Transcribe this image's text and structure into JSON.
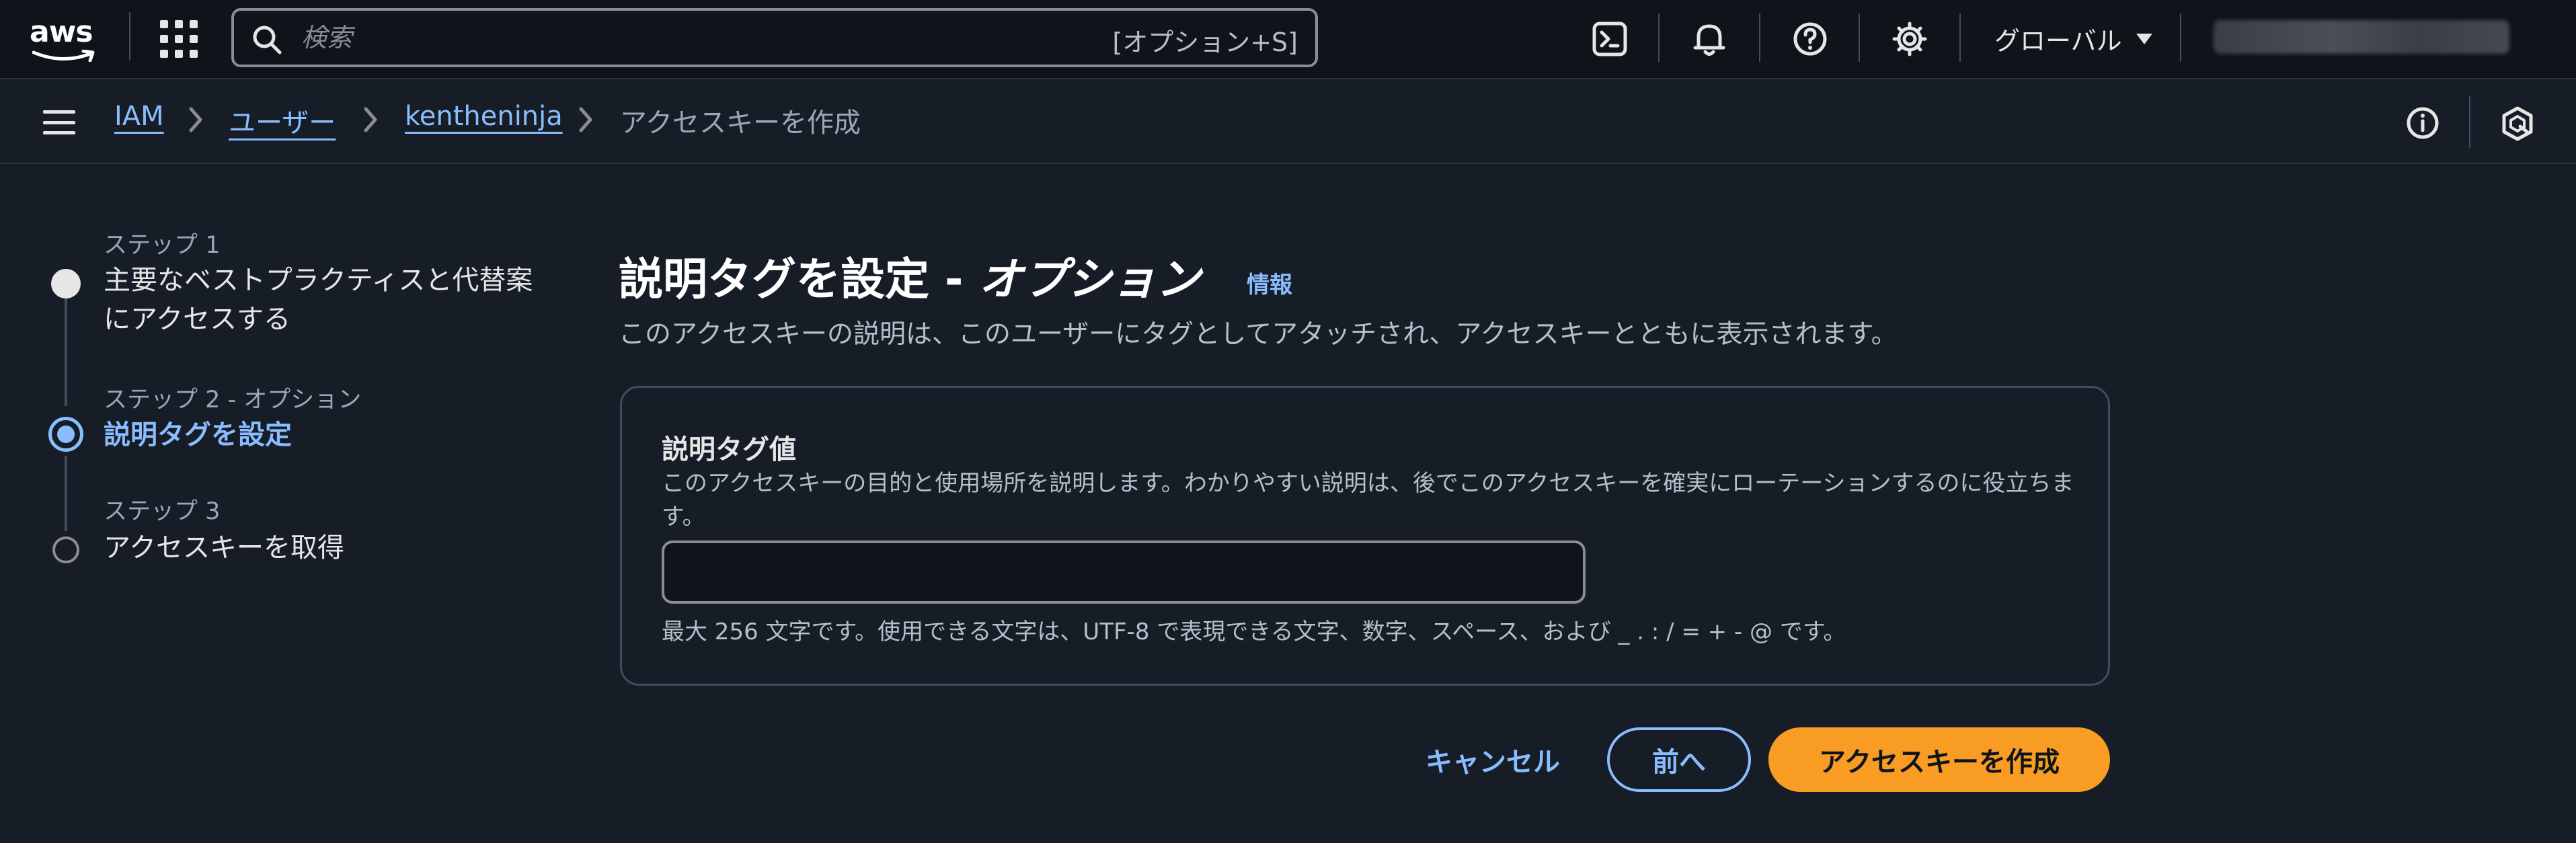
{
  "topnav": {
    "logo_text": "aws",
    "search_placeholder": "検索",
    "search_shortcut": "[オプション+S]",
    "icons": [
      "grid-icon",
      "search-icon",
      "cloudshell-icon",
      "bell-icon",
      "help-icon",
      "gear-icon",
      "caret-down-icon"
    ],
    "region_label": "グローバル"
  },
  "breadcrumb": {
    "items": [
      "IAM",
      "ユーザー",
      "kentheninja",
      "アクセスキーを作成"
    ]
  },
  "steps": [
    {
      "label": "ステップ 1",
      "title_lines": [
        "主要なベストプラクティスと代替案",
        "にアクセスする"
      ],
      "state": "completed"
    },
    {
      "label": "ステップ 2 - オプション",
      "title_lines": [
        "説明タグを設定"
      ],
      "state": "active"
    },
    {
      "label": "ステップ 3",
      "title_lines": [
        "アクセスキーを取得"
      ],
      "state": "pending"
    }
  ],
  "main": {
    "title_main": "説明タグを設定 - ",
    "title_optional": "オプション",
    "info_link": "情報",
    "description": "このアクセスキーの説明は、このユーザーにタグとしてアタッチされ、アクセスキーとともに表示されます。",
    "field": {
      "label": "説明タグ値",
      "description": "このアクセスキーの目的と使用場所を説明します。わかりやすい説明は、後でこのアクセスキーを確実にローテーションするのに役立ちます。",
      "value": "",
      "constraint": "最大 256 文字です。使用できる文字は、UTF-8 で表現できる文字、数字、スペース、および _ . : / = + - @ です。"
    },
    "buttons": {
      "cancel": "キャンセル",
      "previous": "前へ",
      "create": "アクセスキーを作成"
    }
  },
  "colors": {
    "background": "#161d26",
    "nav_background": "#0f141a",
    "link": "#89bdff",
    "primary_button": "#f89c24"
  }
}
